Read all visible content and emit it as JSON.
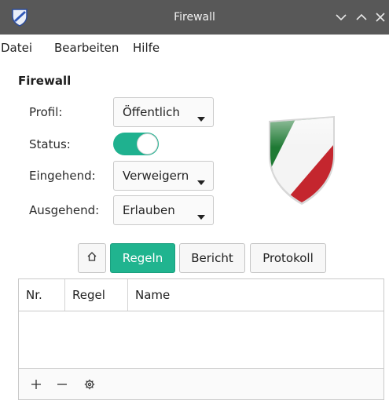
{
  "window": {
    "title": "Firewall",
    "app_icon": "shield-icon",
    "controls": [
      "chevron-down-icon",
      "chevron-up-icon",
      "close-icon"
    ]
  },
  "menubar": {
    "items": [
      {
        "label": "Datei"
      },
      {
        "label": "Bearbeiten"
      },
      {
        "label": "Hilfe"
      }
    ]
  },
  "panel": {
    "title": "Firewall",
    "profile": {
      "label": "Profil:",
      "value": "Öffentlich"
    },
    "status": {
      "label": "Status:",
      "enabled": true,
      "accent": "#1fb18f"
    },
    "incoming": {
      "label": "Eingehend:",
      "value": "Verweigern"
    },
    "outgoing": {
      "label": "Ausgehend:",
      "value": "Erlauben"
    }
  },
  "tabs": {
    "home_icon": "home-icon",
    "items": [
      {
        "label": "Regeln",
        "active": true
      },
      {
        "label": "Bericht",
        "active": false
      },
      {
        "label": "Protokoll",
        "active": false
      }
    ]
  },
  "rules_table": {
    "columns": [
      "Nr.",
      "Regel",
      "Name"
    ],
    "rows": []
  },
  "table_footer": {
    "icons": [
      "add-icon",
      "remove-icon",
      "settings-icon"
    ]
  }
}
